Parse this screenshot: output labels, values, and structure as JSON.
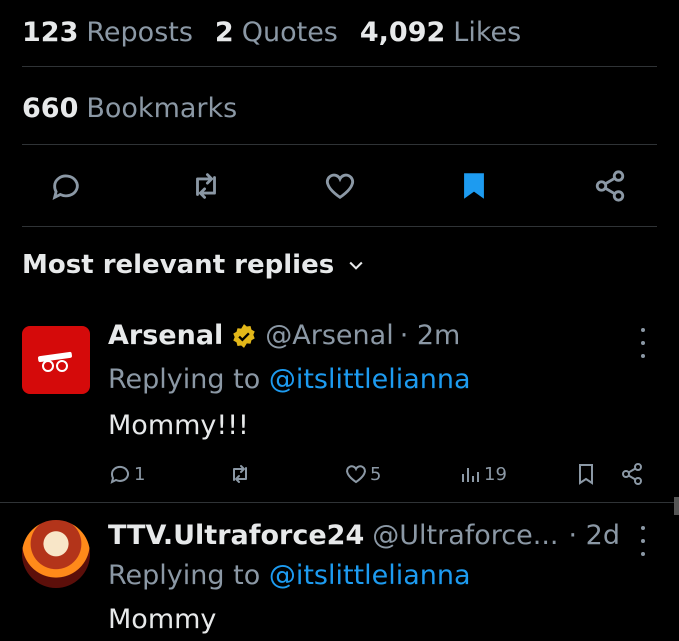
{
  "stats": {
    "reposts": {
      "num": "123",
      "label": "Reposts"
    },
    "quotes": {
      "num": "2",
      "label": "Quotes"
    },
    "likes": {
      "num": "4,092",
      "label": "Likes"
    },
    "bookmarks": {
      "num": "660",
      "label": "Bookmarks"
    }
  },
  "actions": [
    "reply-icon",
    "repost-icon",
    "like-icon",
    "bookmark-filled-icon",
    "share-icon"
  ],
  "sort_label": "Most relevant replies",
  "colors": {
    "accent": "#1d9bf0",
    "muted": "#8b98a5",
    "text": "#e7e9ea",
    "arsenal_red": "#d50a0a",
    "verified_gold": "#e2b719"
  },
  "replies": [
    {
      "name": "Arsenal",
      "handle": "@Arsenal",
      "time": "· 2m",
      "verified": true,
      "replying_prefix": "Replying to",
      "replying_to": "@itslittlelianna",
      "text": "Mommy!!!",
      "counts": {
        "replies": "1",
        "likes": "5",
        "views": "19"
      }
    },
    {
      "name": "TTV.Ultraforce24",
      "handle": "@Ultraforce...",
      "time": "· 2d",
      "verified": false,
      "replying_prefix": "Replying to",
      "replying_to": "@itslittlelianna",
      "text": "Mommy"
    }
  ]
}
